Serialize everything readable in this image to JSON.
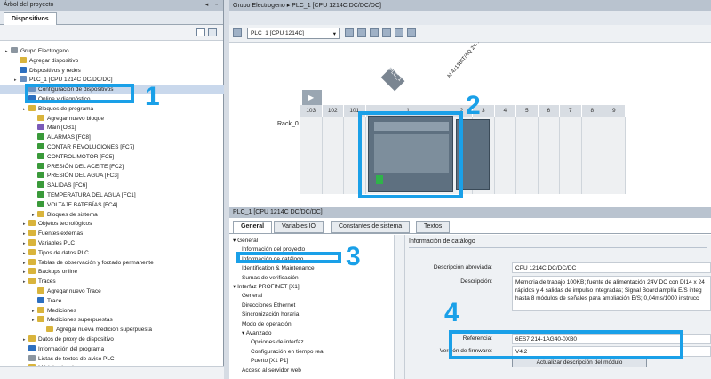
{
  "left_pane": {
    "title": "Árbol del proyecto",
    "tab": "Dispositivos",
    "tree": [
      {
        "label": "Grupo Electrogeno",
        "indent": 0,
        "icon": "project-icon"
      },
      {
        "label": "Agregar dispositivo",
        "indent": 1,
        "icon": "add-device-icon"
      },
      {
        "label": "Dispositivos y redes",
        "indent": 1,
        "icon": "network-icon"
      },
      {
        "label": "PLC_1 [CPU 1214C DC/DC/DC]",
        "indent": 1,
        "icon": "plc-icon"
      },
      {
        "label": "Configuración de dispositivos",
        "indent": 2,
        "icon": "device-config-icon"
      },
      {
        "label": "Online y diagnóstico",
        "indent": 2,
        "icon": "diagnostics-icon"
      },
      {
        "label": "Bloques de programa",
        "indent": 2,
        "icon": "folder-icon"
      },
      {
        "label": "Agregar nuevo bloque",
        "indent": 3,
        "icon": "add-block-icon"
      },
      {
        "label": "Main [OB1]",
        "indent": 3,
        "icon": "ob-block-icon"
      },
      {
        "label": "ALARMAS [FC8]",
        "indent": 3,
        "icon": "fc-block-icon"
      },
      {
        "label": "CONTAR REVOLUCIONES [FC7]",
        "indent": 3,
        "icon": "fc-block-icon"
      },
      {
        "label": "CONTROL MOTOR [FC5]",
        "indent": 3,
        "icon": "fc-block-icon"
      },
      {
        "label": "PRESIÓN DEL ACEITE [FC2]",
        "indent": 3,
        "icon": "fc-block-icon"
      },
      {
        "label": "PRESIÓN DEL AGUA [FC3]",
        "indent": 3,
        "icon": "fc-block-icon"
      },
      {
        "label": "SALIDAS [FC6]",
        "indent": 3,
        "icon": "fc-block-icon"
      },
      {
        "label": "TEMPERATURA DEL AGUA [FC1]",
        "indent": 3,
        "icon": "fc-block-icon"
      },
      {
        "label": "VOLTAJE BATERÍAS [FC4]",
        "indent": 3,
        "icon": "fc-block-icon"
      },
      {
        "label": "Bloques de sistema",
        "indent": 3,
        "icon": "folder-icon"
      },
      {
        "label": "Objetos tecnológicos",
        "indent": 2,
        "icon": "folder-icon"
      },
      {
        "label": "Fuentes externas",
        "indent": 2,
        "icon": "folder-icon"
      },
      {
        "label": "Variables PLC",
        "indent": 2,
        "icon": "folder-icon"
      },
      {
        "label": "Tipos de datos PLC",
        "indent": 2,
        "icon": "folder-icon"
      },
      {
        "label": "Tablas de observación y forzado permanente",
        "indent": 2,
        "icon": "folder-icon"
      },
      {
        "label": "Backups online",
        "indent": 2,
        "icon": "folder-icon"
      },
      {
        "label": "Traces",
        "indent": 2,
        "icon": "folder-icon"
      },
      {
        "label": "Agregar nuevo Trace",
        "indent": 3,
        "icon": "add-trace-icon"
      },
      {
        "label": "Trace",
        "indent": 3,
        "icon": "trace-icon"
      },
      {
        "label": "Mediciones",
        "indent": 3,
        "icon": "folder-icon"
      },
      {
        "label": "Mediciones superpuestas",
        "indent": 3,
        "icon": "folder-icon"
      },
      {
        "label": "Agregar nueva medición superpuesta",
        "indent": 4,
        "icon": "add-trace-icon"
      },
      {
        "label": "Datos de proxy de dispositivo",
        "indent": 2,
        "icon": "folder-icon"
      },
      {
        "label": "Información del programa",
        "indent": 2,
        "icon": "info-icon"
      },
      {
        "label": "Listas de textos de aviso PLC",
        "indent": 2,
        "icon": "list-icon"
      },
      {
        "label": "Módulos locales",
        "indent": 2,
        "icon": "folder-icon"
      }
    ]
  },
  "right_pane": {
    "breadcrumb": [
      "Grupo Electrogeno",
      "PLC_1 [CPU 1214C DC/DC/DC]"
    ],
    "device_select": "PLC_1 [CPU 1214C]",
    "rack_label": "Rack_0",
    "module_label_plc": "PLC_1",
    "module_label_ai": "AI 4x13BIT/AQ 2x...",
    "slots": [
      "103",
      "102",
      "101",
      "1",
      "2",
      "3",
      "4",
      "5",
      "6",
      "7",
      "8",
      "9"
    ]
  },
  "properties": {
    "title": "PLC_1 [CPU 1214C DC/DC/DC]",
    "tabs": [
      "General",
      "Variables IO",
      "Constantes de sistema",
      "Textos"
    ],
    "nav": [
      {
        "label": "General",
        "indent": 0,
        "expanded": true
      },
      {
        "label": "Información del proyecto",
        "indent": 1
      },
      {
        "label": "Información de catálogo",
        "indent": 1
      },
      {
        "label": "Identification & Maintenance",
        "indent": 1
      },
      {
        "label": "Sumas de verificación",
        "indent": 1
      },
      {
        "label": "Interfaz PROFINET [X1]",
        "indent": 0,
        "expanded": true
      },
      {
        "label": "General",
        "indent": 1
      },
      {
        "label": "Direcciones Ethernet",
        "indent": 1
      },
      {
        "label": "Sincronización horaria",
        "indent": 1
      },
      {
        "label": "Modo de operación",
        "indent": 1
      },
      {
        "label": "Avanzado",
        "indent": 1,
        "expanded": true
      },
      {
        "label": "Opciones de interfaz",
        "indent": 2
      },
      {
        "label": "Configuración en tiempo real",
        "indent": 2
      },
      {
        "label": "Puerto [X1 P1]",
        "indent": 2
      },
      {
        "label": "Acceso al servidor web",
        "indent": 1
      }
    ],
    "section_title": "Información de catálogo",
    "fields": {
      "short_desc_label": "Descripción abreviada:",
      "short_desc_value": "CPU 1214C DC/DC/DC",
      "desc_label": "Descripción:",
      "desc_lines": [
        "Memoria de trabajo 100KB; fuente de alimentación 24V DC con DI14 x 24",
        "rápidos y 4 salidas de impulso integradas; Signal Board amplía E/S integ",
        "hasta 8 módulos de señales para ampliación E/S; 0,04ms/1000 instrucc"
      ],
      "ref_label": "Referencia:",
      "ref_value": "6ES7 214-1AG40-0XB0",
      "fw_label": "Versión de firmware:",
      "fw_value": "V4.2",
      "update_button": "Actualizar descripción del módulo"
    }
  },
  "annotations": [
    "1",
    "2",
    "3",
    "4"
  ],
  "colors": {
    "annotation": "#1aa0e8",
    "title_bar": "#b9c3cf"
  }
}
